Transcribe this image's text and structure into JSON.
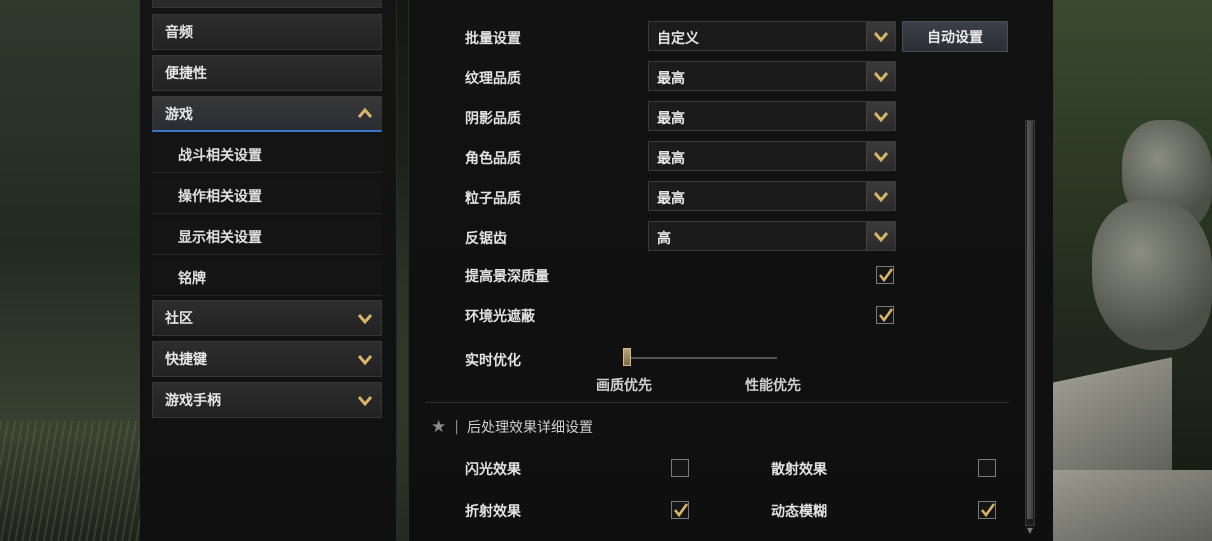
{
  "sidebar": {
    "items": [
      {
        "label": "音频",
        "expanded": null
      },
      {
        "label": "便捷性",
        "expanded": null
      },
      {
        "label": "游戏",
        "expanded": true
      },
      {
        "label": "社区",
        "expanded": false
      },
      {
        "label": "快捷键",
        "expanded": false
      },
      {
        "label": "游戏手柄",
        "expanded": false
      }
    ],
    "subitems": [
      {
        "label": "战斗相关设置"
      },
      {
        "label": "操作相关设置"
      },
      {
        "label": "显示相关设置"
      },
      {
        "label": "铭牌"
      }
    ]
  },
  "graphics": {
    "batch": {
      "label": "批量设置",
      "value": "自定义",
      "auto_button": "自动设置"
    },
    "rows": [
      {
        "label": "纹理品质",
        "value": "最高"
      },
      {
        "label": "阴影品质",
        "value": "最高"
      },
      {
        "label": "角色品质",
        "value": "最高"
      },
      {
        "label": "粒子品质",
        "value": "最高"
      },
      {
        "label": "反锯齿",
        "value": "高"
      }
    ],
    "checks": [
      {
        "label": "提高景深质量",
        "checked": true
      },
      {
        "label": "环境光遮蔽",
        "checked": true
      }
    ],
    "realtime": {
      "label": "实时优化",
      "left_label": "画质优先",
      "right_label": "性能优先",
      "level": 0.0
    }
  },
  "post": {
    "title": "后处理效果详细设置",
    "items": [
      {
        "label": "闪光效果",
        "checked": false
      },
      {
        "label": "散射效果",
        "checked": false
      },
      {
        "label": "折射效果",
        "checked": true
      },
      {
        "label": "动态模糊",
        "checked": true
      }
    ]
  },
  "colors": {
    "accent_gold": "#d8b56a",
    "active_underline": "#3c78c8"
  }
}
